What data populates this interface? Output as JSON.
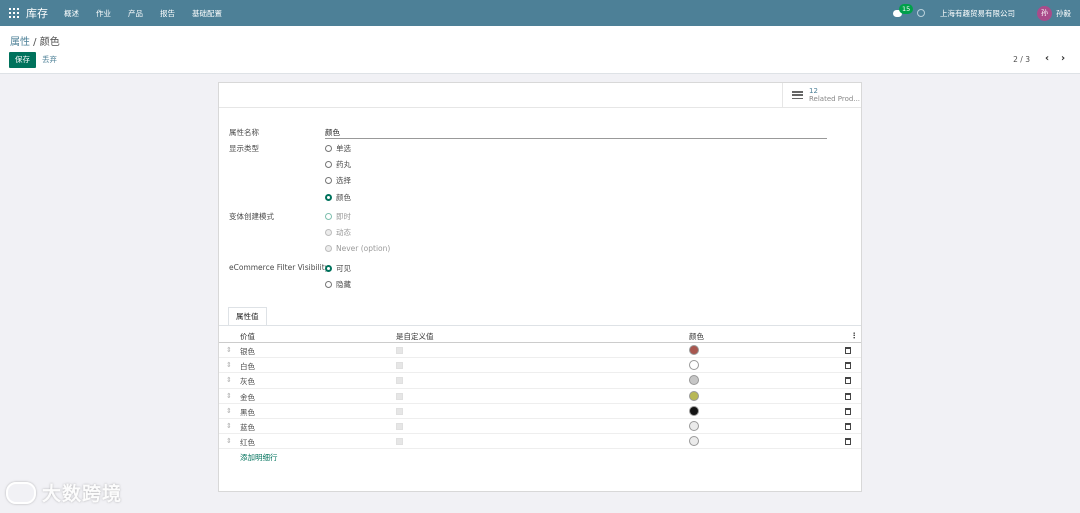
{
  "nav": {
    "brand": "库存",
    "menu": [
      "概述",
      "作业",
      "产品",
      "报告",
      "基础配置"
    ],
    "chat_count": "15",
    "company": "上海有趣贸易有限公司",
    "avatar_initial": "孙",
    "user": "孙毅"
  },
  "control": {
    "breadcrumb_parent": "属性",
    "breadcrumb_sep": " / ",
    "breadcrumb_current": "颜色",
    "save_label": "保存",
    "discard_label": "丢弃",
    "pager": "2 / 3",
    "pager_prev": "‹",
    "pager_next": "›"
  },
  "stat_button": {
    "value": "12",
    "label": "Related Prod..."
  },
  "form": {
    "name_label": "属性名称",
    "name_value": "颜色",
    "display_type_label": "显示类型",
    "display_types": [
      {
        "label": "单选",
        "checked": false
      },
      {
        "label": "药丸",
        "checked": false
      },
      {
        "label": "选择",
        "checked": false
      },
      {
        "label": "颜色",
        "checked": true
      }
    ],
    "variant_label": "变体创建模式",
    "variant_modes": [
      {
        "label": "即时",
        "checked": true
      },
      {
        "label": "动态",
        "checked": false
      },
      {
        "label": "Never (option)",
        "checked": false
      }
    ],
    "ecommerce_label": "eCommerce Filter Visibility",
    "ecommerce_options": [
      {
        "label": "可见",
        "checked": true
      },
      {
        "label": "隐藏",
        "checked": false
      }
    ]
  },
  "tab": {
    "label": "属性值"
  },
  "table": {
    "headers": {
      "value": "价值",
      "custom": "是自定义值",
      "color": "颜色",
      "options": "⋮"
    },
    "rows": [
      {
        "value": "银色",
        "color": "#a8574f"
      },
      {
        "value": "白色",
        "color": "#ffffff"
      },
      {
        "value": "灰色",
        "color": "#c6c6c6"
      },
      {
        "value": "金色",
        "color": "#b8b856"
      },
      {
        "value": "黑色",
        "color": "#141414"
      },
      {
        "value": "蓝色",
        "color": "#ebebeb"
      },
      {
        "value": "红色",
        "color": "#ebebeb"
      }
    ],
    "add_line": "添加明细行"
  },
  "watermark": "大数跨境"
}
